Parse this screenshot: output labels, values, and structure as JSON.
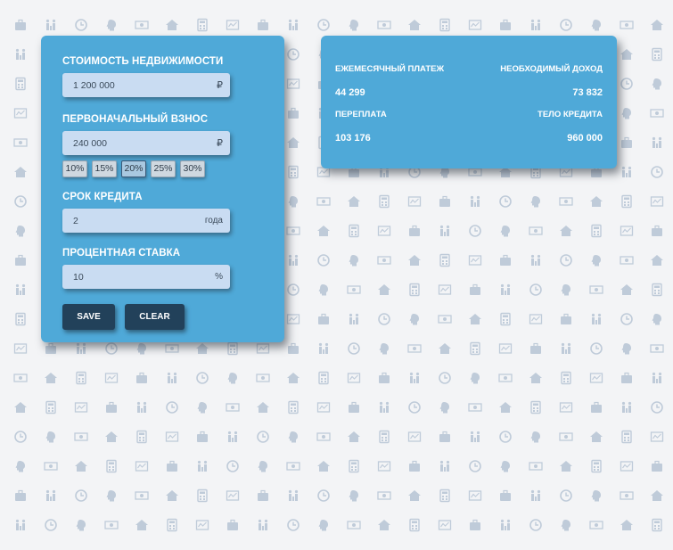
{
  "form": {
    "property_cost": {
      "label": "СТОИМОСТЬ НЕДВИЖИМОСТИ",
      "value": "1 200 000",
      "unit": "₽"
    },
    "down_payment": {
      "label": "ПЕРВОНАЧАЛЬНЫЙ ВЗНОС",
      "value": "240 000",
      "unit": "₽",
      "percent_options": [
        "10%",
        "15%",
        "20%",
        "25%",
        "30%"
      ],
      "selected_percent": "20%"
    },
    "term": {
      "label": "СРОК КРЕДИТА",
      "value": "2",
      "unit": "года"
    },
    "rate": {
      "label": "ПРОЦЕНТНАЯ СТАВКА",
      "value": "10",
      "unit": "%"
    },
    "save_label": "SAVE",
    "clear_label": "CLEAR"
  },
  "results": {
    "monthly_payment": {
      "label": "ЕЖЕМЕСЯЧНЫЙ ПЛАТЕЖ",
      "value": "44 299"
    },
    "required_income": {
      "label": "НЕОБХОДИМЫЙ ДОХОД",
      "value": "73 832"
    },
    "overpayment": {
      "label": "ПЕРЕПЛАТА",
      "value": "103 176"
    },
    "loan_body": {
      "label": "ТЕЛО КРЕДИТА",
      "value": "960 000"
    }
  },
  "theme": {
    "card_color": "#4fa9d8",
    "input_color": "#c9dcf2",
    "button_color": "#22415a",
    "pattern_color": "#bfcbd9"
  },
  "background_icons": [
    "briefcase-icon",
    "house-icon",
    "clock-icon",
    "chart-icon",
    "money-icon",
    "family-icon",
    "calculator-icon",
    "head-icon"
  ]
}
